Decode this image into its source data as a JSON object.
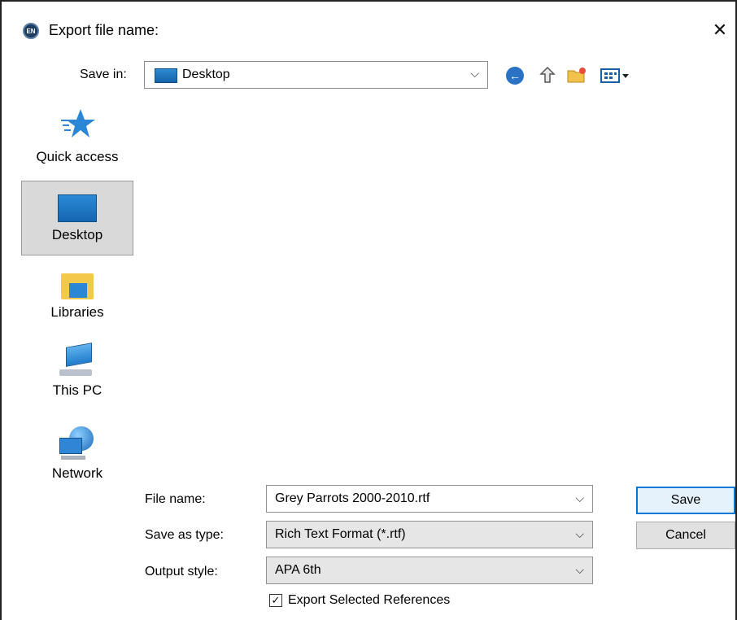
{
  "window": {
    "title": "Export file name:",
    "app_icon_text": "EN"
  },
  "toolbar": {
    "save_in_label": "Save in:",
    "save_in_value": "Desktop",
    "icons": [
      "back-icon",
      "up-folder-icon",
      "new-folder-icon",
      "views-menu-icon"
    ]
  },
  "places": [
    {
      "label": "Quick access",
      "icon": "star-icon"
    },
    {
      "label": "Desktop",
      "icon": "desktop-icon",
      "selected": true
    },
    {
      "label": "Libraries",
      "icon": "libraries-icon"
    },
    {
      "label": "This PC",
      "icon": "computer-icon"
    },
    {
      "label": "Network",
      "icon": "network-icon"
    }
  ],
  "form": {
    "file_name_label": "File name:",
    "file_name_value": "Grey Parrots 2000-2010.rtf",
    "save_as_type_label": "Save as type:",
    "save_as_type_value": "Rich Text Format (*.rtf)",
    "output_style_label": "Output style:",
    "output_style_value": "APA 6th",
    "export_selected_label": "Export Selected References",
    "export_selected_checked": true
  },
  "buttons": {
    "save": "Save",
    "cancel": "Cancel"
  },
  "colors": {
    "accent": "#0078d7",
    "selected_place_bg": "#d9d9d9",
    "folder_blue": "#1f74c2"
  }
}
